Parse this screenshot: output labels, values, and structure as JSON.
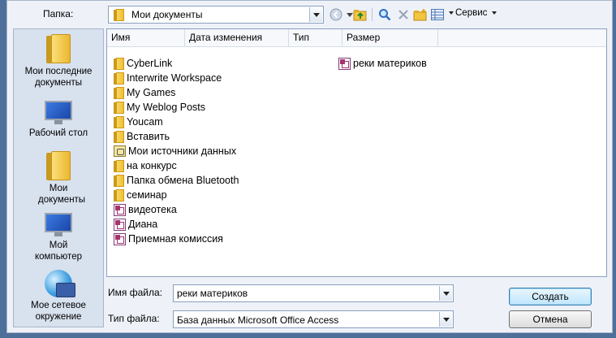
{
  "toolbar": {
    "folder_label": "Папка:",
    "folder_value": "Мои документы",
    "service_label": "Сервис"
  },
  "places": [
    {
      "name": "recent",
      "label": "Мои последние документы",
      "icon": "recent-folder-icon"
    },
    {
      "name": "desktop",
      "label": "Рабочий стол",
      "icon": "desktop-icon"
    },
    {
      "name": "documents",
      "label": "Мои документы",
      "icon": "documents-folder-icon"
    },
    {
      "name": "computer",
      "label": "Мой компьютер",
      "icon": "computer-icon"
    },
    {
      "name": "network",
      "label": "Мое сетевое окружение",
      "icon": "network-globe-icon"
    }
  ],
  "columns": [
    "Имя",
    "Дата изменения",
    "Тип",
    "Размер"
  ],
  "files": [
    {
      "name": "CyberLink",
      "icon": "folder-icon"
    },
    {
      "name": "Interwrite Workspace",
      "icon": "folder-icon"
    },
    {
      "name": "My Games",
      "icon": "folder-icon"
    },
    {
      "name": "My Weblog Posts",
      "icon": "folder-icon"
    },
    {
      "name": "Youcam",
      "icon": "folder-icon"
    },
    {
      "name": "Вставить",
      "icon": "folder-icon"
    },
    {
      "name": "Мои источники данных",
      "icon": "data-source-folder-icon"
    },
    {
      "name": "на конкурс",
      "icon": "folder-icon"
    },
    {
      "name": "Папка обмена Bluetooth",
      "icon": "folder-icon"
    },
    {
      "name": "семинар",
      "icon": "folder-icon"
    },
    {
      "name": "видеотека",
      "icon": "access-db-icon"
    },
    {
      "name": "Диана",
      "icon": "access-db-icon"
    },
    {
      "name": "Приемная комиссия",
      "icon": "access-db-icon"
    }
  ],
  "files_col2": [
    {
      "name": "реки материков",
      "icon": "access-db-icon"
    }
  ],
  "bottom": {
    "filename_label": "Имя файла:",
    "filename_value": "реки материков",
    "filetype_label": "Тип файла:",
    "filetype_value": "База данных Microsoft Office Access",
    "create_button": "Создать",
    "cancel_button": "Отмена"
  }
}
